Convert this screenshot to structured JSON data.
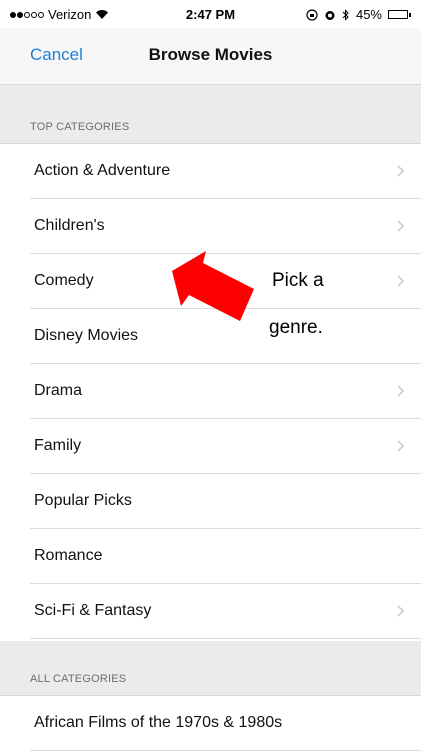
{
  "status_bar": {
    "carrier": "Verizon",
    "signal_bars": 2,
    "time": "2:47 PM",
    "battery": "45%",
    "battery_level": 0.45
  },
  "nav": {
    "cancel_label": "Cancel",
    "title": "Browse Movies"
  },
  "sections": {
    "top": {
      "header": "TOP CATEGORIES",
      "items": [
        {
          "label": "Action & Adventure",
          "chevron": true
        },
        {
          "label": "Children's",
          "chevron": true
        },
        {
          "label": "Comedy",
          "chevron": true
        },
        {
          "label": "Disney Movies",
          "chevron": false
        },
        {
          "label": "Drama",
          "chevron": true
        },
        {
          "label": "Family",
          "chevron": true
        },
        {
          "label": "Popular Picks",
          "chevron": false
        },
        {
          "label": "Romance",
          "chevron": false
        },
        {
          "label": "Sci-Fi & Fantasy",
          "chevron": true
        }
      ]
    },
    "all": {
      "header": "ALL CATEGORIES",
      "items": [
        {
          "label": "African Films of the 1970s & 1980s",
          "chevron": false
        }
      ]
    }
  },
  "annotation": {
    "line1": "Pick a",
    "line2": "genre.",
    "arrow_color": "#ff0000"
  },
  "colors": {
    "accent": "#1f7fd6",
    "section_bg": "#ebebeb",
    "separator": "#dcdcdc"
  }
}
